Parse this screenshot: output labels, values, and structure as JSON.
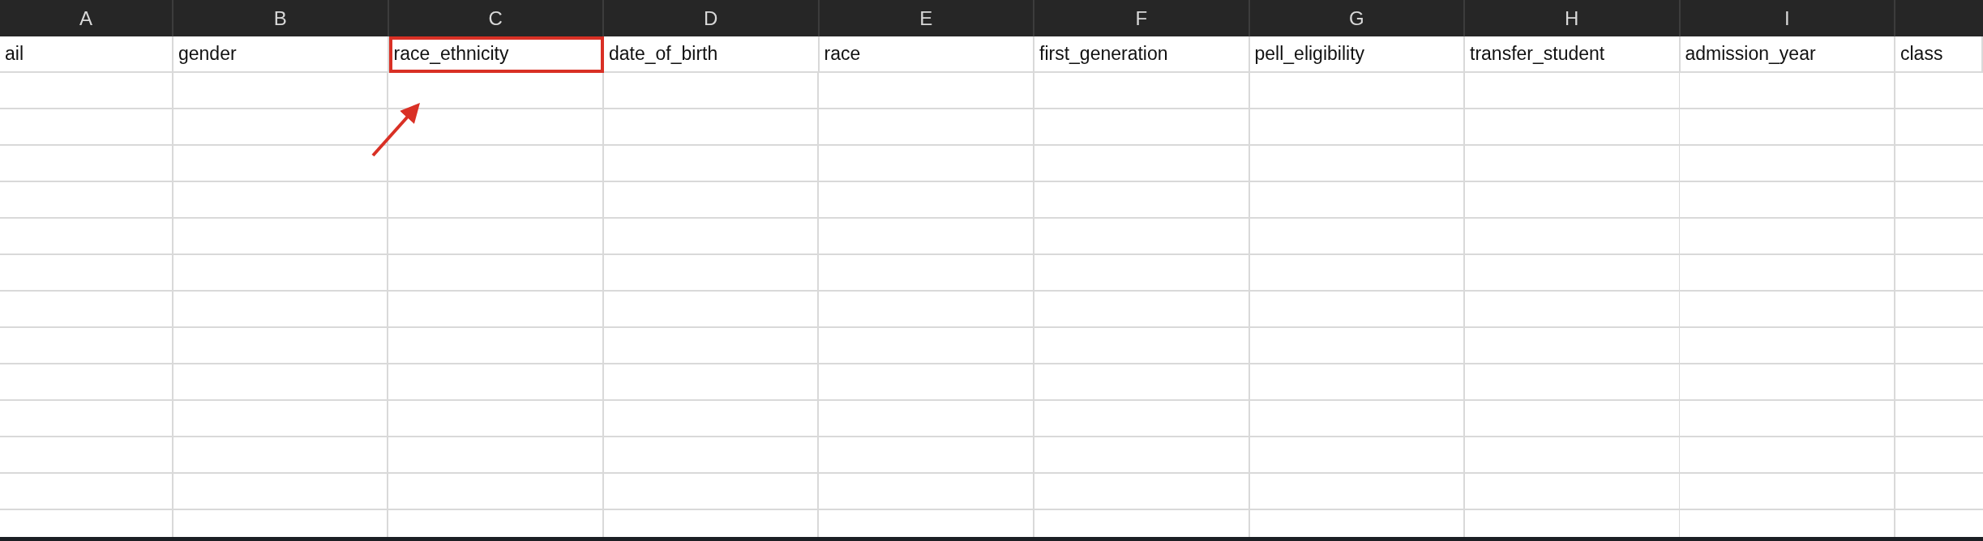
{
  "column_headers": [
    {
      "label": "A"
    },
    {
      "label": "B"
    },
    {
      "label": "C"
    },
    {
      "label": "D"
    },
    {
      "label": "E"
    },
    {
      "label": "F"
    },
    {
      "label": "G"
    },
    {
      "label": "H"
    },
    {
      "label": "I"
    }
  ],
  "header_row": [
    {
      "text": "ail",
      "highlighted": false
    },
    {
      "text": "gender",
      "highlighted": false
    },
    {
      "text": "race_ethnicity",
      "highlighted": true
    },
    {
      "text": "date_of_birth",
      "highlighted": false
    },
    {
      "text": "race",
      "highlighted": false
    },
    {
      "text": "first_generation",
      "highlighted": false
    },
    {
      "text": "pell_eligibility",
      "highlighted": false
    },
    {
      "text": "transfer_student",
      "highlighted": false
    },
    {
      "text": "admission_year",
      "highlighted": false
    },
    {
      "text": "class",
      "highlighted": false
    }
  ]
}
